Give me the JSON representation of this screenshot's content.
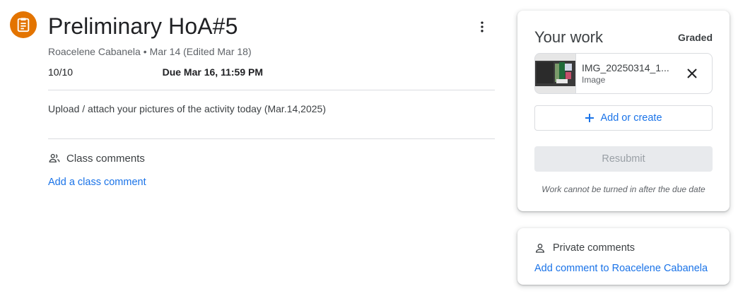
{
  "assignment": {
    "icon": "assignment-icon",
    "title": "Preliminary HoA#5",
    "author": "Roacelene Cabanela",
    "separator": "•",
    "posted": "Mar 14 (Edited Mar 18)",
    "points": "10/10",
    "due": "Due Mar 16, 11:59 PM",
    "description": "Upload / attach your pictures of the activity today (Mar.14,2025)",
    "accent_color": "#e37400"
  },
  "class_comments": {
    "icon": "people-icon",
    "heading": "Class comments",
    "add_link": "Add a class comment"
  },
  "your_work": {
    "title": "Your work",
    "status": "Graded",
    "attachment": {
      "name": "IMG_20250314_1...",
      "type": "Image"
    },
    "add_or_create": "Add or create",
    "resubmit": "Resubmit",
    "note": "Work cannot be turned in after the due date"
  },
  "private_comments": {
    "icon": "person-icon",
    "heading": "Private comments",
    "add_link": "Add comment to Roacelene Cabanela"
  },
  "colors": {
    "link": "#1a73e8",
    "text": "#3c4043",
    "muted": "#5f6368",
    "divider": "#dadce0"
  }
}
